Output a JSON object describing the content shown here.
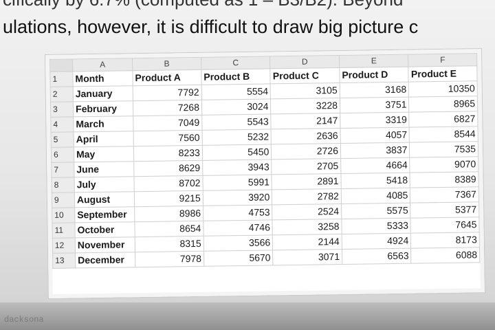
{
  "document": {
    "text_line_1": "cifically by 6.7% (computed as 1 – B3/B2). Beyond",
    "text_line_2": "ulations, however, it is difficult to draw big picture c"
  },
  "spreadsheet": {
    "column_letters": [
      "A",
      "B",
      "C",
      "D",
      "E",
      "F"
    ],
    "header_row": {
      "row_number": "1",
      "cells": [
        "Month",
        "Product A",
        "Product B",
        "Product C",
        "Product D",
        "Product E"
      ]
    },
    "rows": [
      {
        "row_number": "2",
        "month": "January",
        "values": [
          "7792",
          "5554",
          "3105",
          "3168",
          "10350"
        ]
      },
      {
        "row_number": "3",
        "month": "February",
        "values": [
          "7268",
          "3024",
          "3228",
          "3751",
          "8965"
        ]
      },
      {
        "row_number": "4",
        "month": "March",
        "values": [
          "7049",
          "5543",
          "2147",
          "3319",
          "6827"
        ]
      },
      {
        "row_number": "5",
        "month": "April",
        "values": [
          "7560",
          "5232",
          "2636",
          "4057",
          "8544"
        ]
      },
      {
        "row_number": "6",
        "month": "May",
        "values": [
          "8233",
          "5450",
          "2726",
          "3837",
          "7535"
        ]
      },
      {
        "row_number": "7",
        "month": "June",
        "values": [
          "8629",
          "3943",
          "2705",
          "4664",
          "9070"
        ]
      },
      {
        "row_number": "8",
        "month": "July",
        "values": [
          "8702",
          "5991",
          "2891",
          "5418",
          "8389"
        ]
      },
      {
        "row_number": "9",
        "month": "August",
        "values": [
          "9215",
          "3920",
          "2782",
          "4085",
          "7367"
        ]
      },
      {
        "row_number": "10",
        "month": "September",
        "values": [
          "8986",
          "4753",
          "2524",
          "5575",
          "5377"
        ]
      },
      {
        "row_number": "11",
        "month": "October",
        "values": [
          "8654",
          "4746",
          "3258",
          "5333",
          "7645"
        ]
      },
      {
        "row_number": "12",
        "month": "November",
        "values": [
          "8315",
          "3566",
          "2144",
          "4924",
          "8173"
        ]
      },
      {
        "row_number": "13",
        "month": "December",
        "values": [
          "7978",
          "5670",
          "3071",
          "6563",
          "6088"
        ]
      }
    ]
  },
  "footer": {
    "partial_text": "dacksona"
  }
}
